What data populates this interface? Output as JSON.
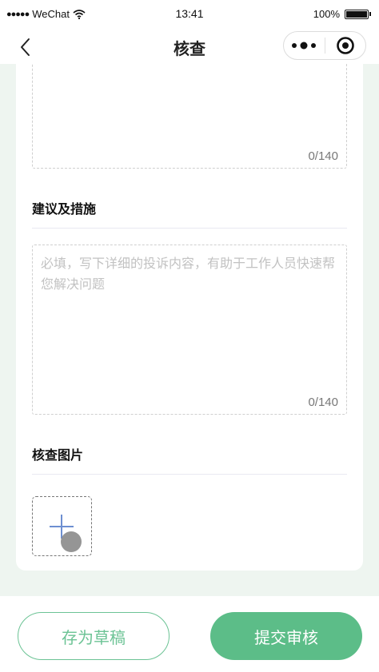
{
  "status_bar": {
    "signal_dots": "●●●●●",
    "carrier": "WeChat",
    "time": "13:41",
    "battery": "100%"
  },
  "nav": {
    "title": "核查",
    "back_icon": "chevron-left-icon",
    "more_icon": "more-dots-icon",
    "close_icon": "target-circle-icon"
  },
  "form": {
    "first_textarea": {
      "value": "",
      "counter": "0/140"
    },
    "measures": {
      "title": "建议及措施",
      "placeholder": "必填，写下详细的投诉内容，有助于工作人员快速帮您解决问题",
      "counter": "0/140"
    },
    "images": {
      "title": "核查图片",
      "add_icon": "plus-icon"
    }
  },
  "actions": {
    "save_draft_label": "存为草稿",
    "submit_label": "提交审核"
  },
  "colors": {
    "accent": "#5cbd88",
    "accent_outline": "#6cc395",
    "page_bg": "#eef5f0",
    "add_icon": "#6d8fd1"
  }
}
